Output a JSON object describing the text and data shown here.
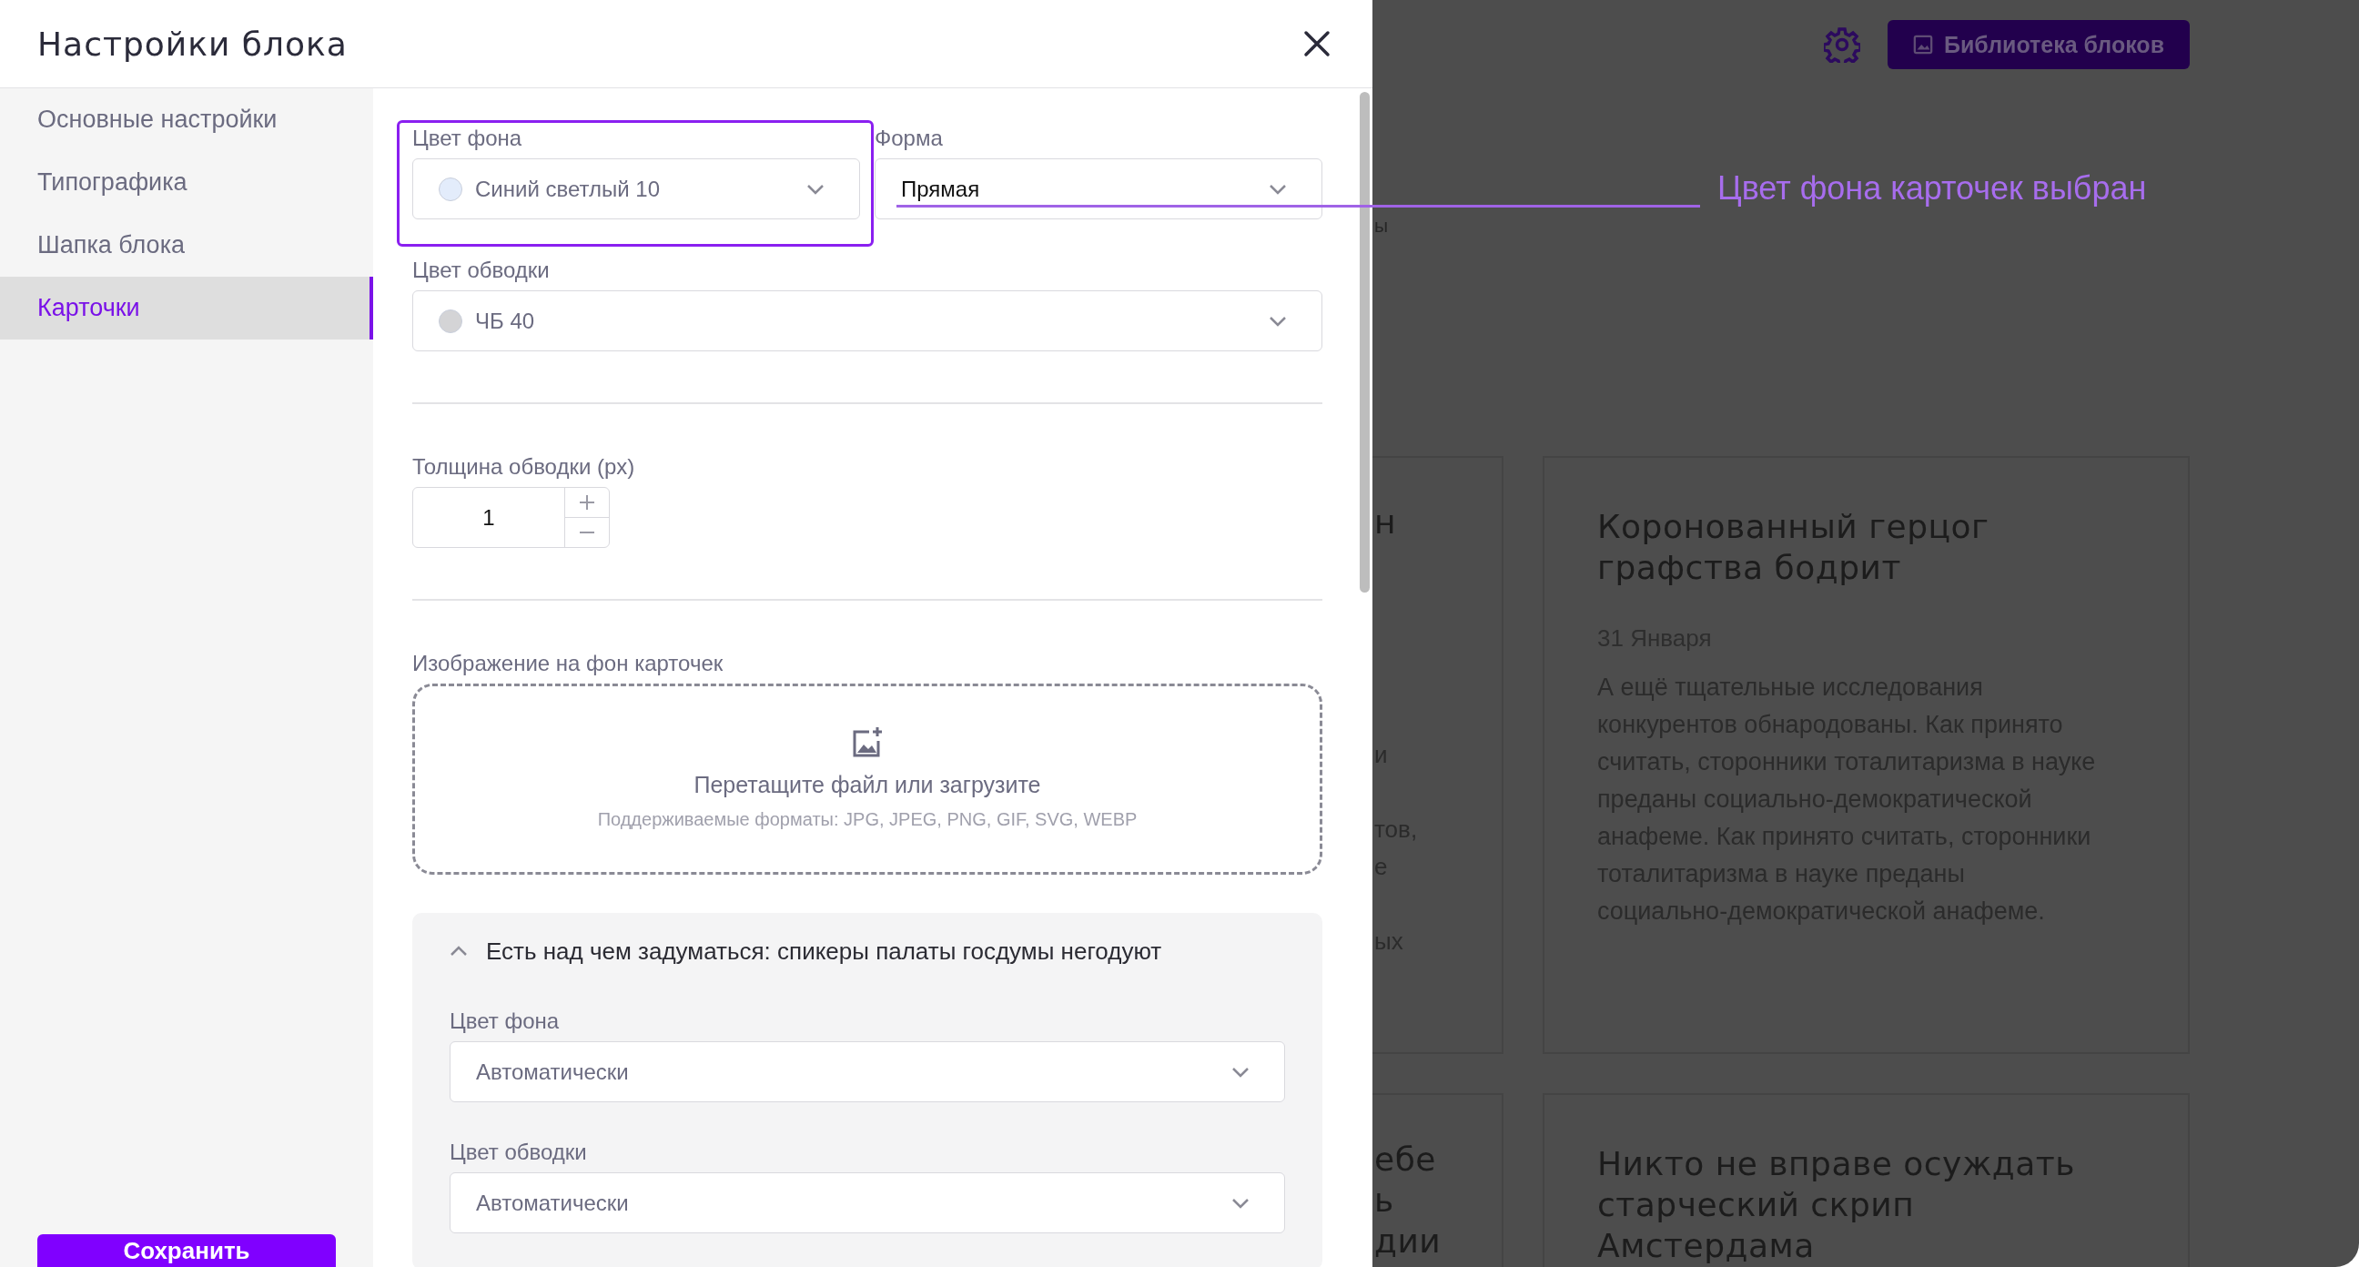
{
  "dialog": {
    "title": "Настройки блока"
  },
  "sidebar": {
    "items": [
      {
        "label": "Основные настройки",
        "selected": false
      },
      {
        "label": "Типографика",
        "selected": false
      },
      {
        "label": "Шапка блока",
        "selected": false
      },
      {
        "label": "Карточки",
        "selected": true
      }
    ],
    "save_button": "Сохранить"
  },
  "form": {
    "background_color": {
      "label": "Цвет фона",
      "value": "Синий светлый 10",
      "color": "#e3ecfb",
      "highlighted": true
    },
    "shape": {
      "label": "Форма",
      "value": "Прямая"
    },
    "border_color": {
      "label": "Цвет обводки",
      "value": "ЧБ 40",
      "color": "#d4d4d6"
    },
    "border_width": {
      "label": "Толщина обводки (px)",
      "value": "1"
    },
    "image_upload": {
      "label": "Изображение на фон карточек",
      "prompt": "Перетащите файл или загрузите",
      "formats": "Поддерживаемые форматы: JPG, JPEG, PNG, GIF, SVG, WEBP"
    },
    "accordion": {
      "title": "Есть над чем задуматься: спикеры палаты госдумы негодуют",
      "expanded": true,
      "fields": [
        {
          "label": "Цвет фона",
          "value": "Автоматически"
        },
        {
          "label": "Цвет обводки",
          "value": "Автоматически"
        }
      ]
    }
  },
  "annotation": {
    "text": "Цвет фона карточек выбран"
  },
  "background_page": {
    "library_button": "Библиотека блоков",
    "fragment": "ы",
    "rows": [
      {
        "left_card": {
          "title": "н",
          "lines": [
            "и",
            "тов,",
            "е",
            "ых"
          ]
        },
        "card": {
          "title": "Коронованный герцог графства бодрит",
          "date": "31 Января",
          "body": "А ещё тщательные исследования конкурентов обнародованы. Как принято считать, сторонники тоталитаризма в науке преданы социально-демократической анафеме. Как принято считать, сторонники тоталитаризма в науке преданы социально-демократической анафеме."
        }
      },
      {
        "left_card": {
          "title_lines": [
            "ебе",
            "ь",
            "дии"
          ]
        },
        "card": {
          "title": "Никто не вправе осуждать старческий скрип Амстердама"
        }
      }
    ]
  }
}
